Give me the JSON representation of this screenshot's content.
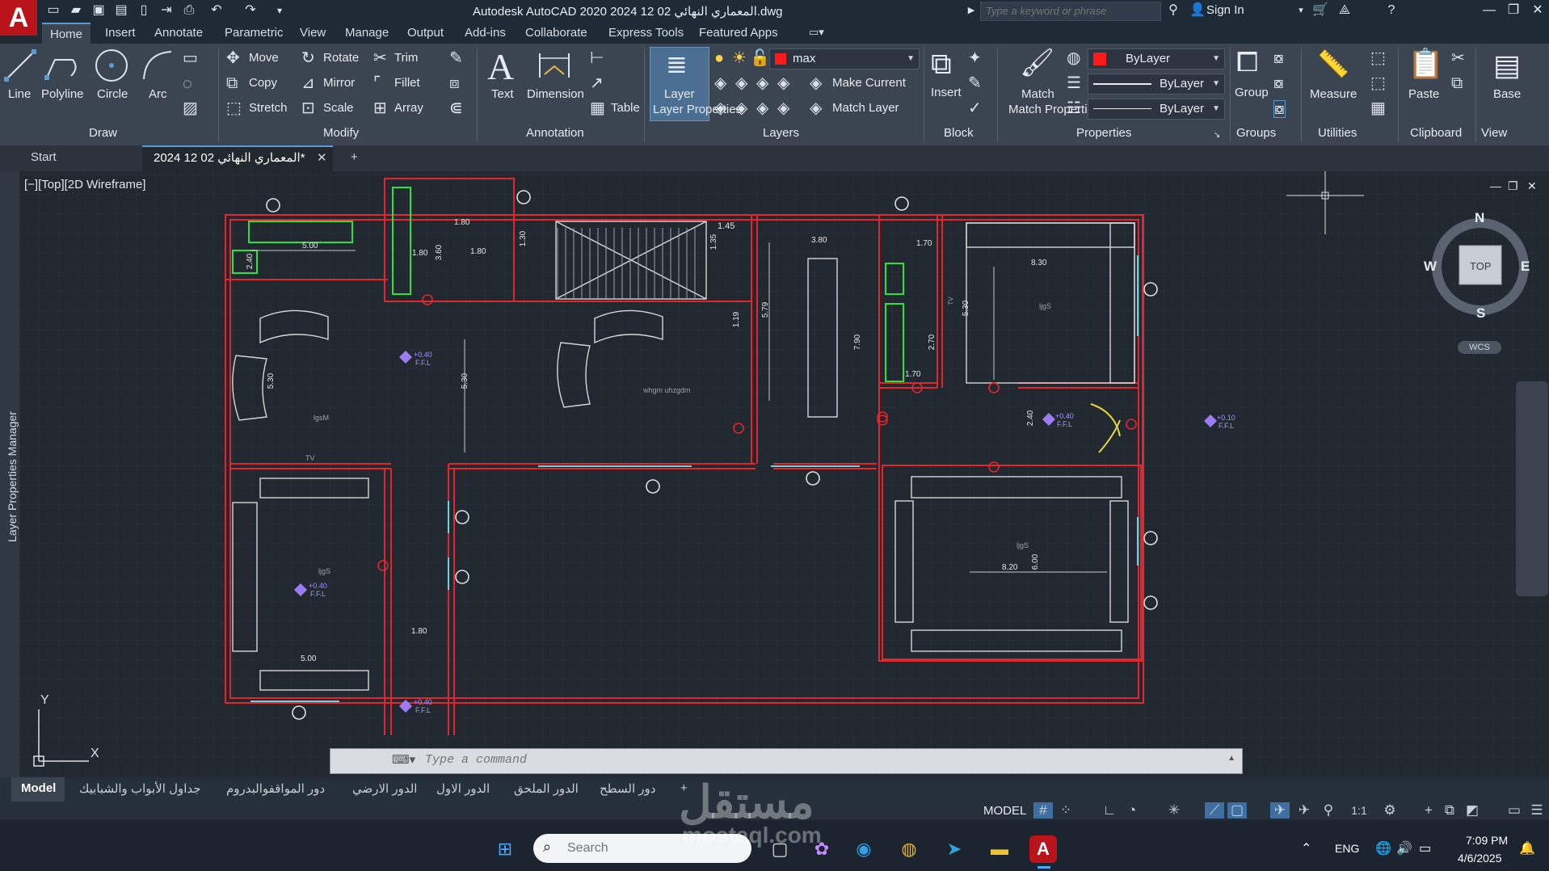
{
  "titlebar": {
    "title": "Autodesk AutoCAD 2020    2024 12 02  المعماري النهائي.dwg",
    "search_placeholder": "Type a keyword or phrase",
    "sign_in": "Sign In"
  },
  "ribbon_tabs": [
    "Home",
    "Insert",
    "Annotate",
    "Parametric",
    "View",
    "Manage",
    "Output",
    "Add-ins",
    "Collaborate",
    "Express Tools",
    "Featured Apps"
  ],
  "draw": {
    "line": "Line",
    "polyline": "Polyline",
    "circle": "Circle",
    "arc": "Arc",
    "panel": "Draw"
  },
  "modify": {
    "move": "Move",
    "rotate": "Rotate",
    "trim": "Trim",
    "copy": "Copy",
    "mirror": "Mirror",
    "fillet": "Fillet",
    "stretch": "Stretch",
    "scale": "Scale",
    "array": "Array",
    "panel": "Modify"
  },
  "annotation": {
    "text": "Text",
    "dimension": "Dimension",
    "table": "Table",
    "panel": "Annotation"
  },
  "layers": {
    "layer_properties": "Layer Properties",
    "current_layer": "max",
    "make_current": "Make Current",
    "match_layer": "Match Layer",
    "panel": "Layers",
    "layer_color": "#ff1a1a"
  },
  "block": {
    "insert": "Insert",
    "panel": "Block"
  },
  "properties": {
    "match_properties": "Match Properties",
    "color": "ByLayer",
    "linetype": "ByLayer",
    "lineweight": "ByLayer",
    "panel": "Properties",
    "color_swatch": "#ff1a1a"
  },
  "groups": {
    "group": "Group",
    "panel": "Groups"
  },
  "utilities": {
    "measure": "Measure",
    "panel": "Utilities"
  },
  "clipboard": {
    "paste": "Paste",
    "panel": "Clipboard"
  },
  "view": {
    "base": "Base",
    "panel": "View"
  },
  "doc_tabs": {
    "start": "Start",
    "drawing": "2024 12 02  المعماري النهائي*"
  },
  "viewport_label": "[−][Top][2D Wireframe]",
  "sidebar_label": "Layer Properties Manager",
  "viewcube": {
    "north": "N",
    "south": "S",
    "east": "E",
    "west": "W",
    "top": "TOP",
    "wcs": "WCS"
  },
  "ucs": {
    "x": "X",
    "y": "Y"
  },
  "drawing_texts": {
    "d500a": "5.00",
    "d180a": "1.80",
    "d360": "3.60",
    "d180b": "1.80",
    "d180c": "1.80",
    "d130": "1.30",
    "d145": "1.45",
    "d135": "1.35",
    "d119": "1.19",
    "d579": "5.79",
    "d380": "3.80",
    "d790": "7.90",
    "d170a": "1.70",
    "d270": "2.70",
    "d170b": "1.70",
    "d530a": "5.30",
    "d830": "8.30",
    "d530b": "5.30",
    "d530c": "5.30",
    "d240a": "2.40",
    "d240b": "2.40",
    "d820": "8.20",
    "d600": "6.00",
    "d500b": "5.00",
    "d180d": "1.80",
    "lvl1": "+0.40",
    "ffl1": "F.F.L",
    "lvl2": "+0.40",
    "ffl2": "F.F.L",
    "lvl3": "+0.40",
    "ffl3": "F.F.L",
    "lvl4": "+0.40",
    "ffl4": "F.F.L",
    "lvl5": "+0.10",
    "ffl5": "F.F.L",
    "room1": "lgsM",
    "room2": "whgm uhzgdm",
    "room3": "ljgS",
    "room4": "ljgS",
    "room5": "ljgS",
    "tv1": "TV",
    "tv2": "TV"
  },
  "command": {
    "placeholder": "Type a command"
  },
  "layout_tabs": [
    "Model",
    "جداول الأبواب والشبابيك",
    "دور المواقفوالبدروم",
    "الدور الارضي",
    "الدور الاول",
    "الدور الملحق",
    "دور السطح"
  ],
  "status": {
    "model": "MODEL",
    "scale": "1:1"
  },
  "taskbar": {
    "search": "Search",
    "lang": "ENG",
    "time": "7:09 PM",
    "date": "4/6/2025"
  },
  "watermark": {
    "ar": "مستقل",
    "en": "mostaql.com"
  }
}
